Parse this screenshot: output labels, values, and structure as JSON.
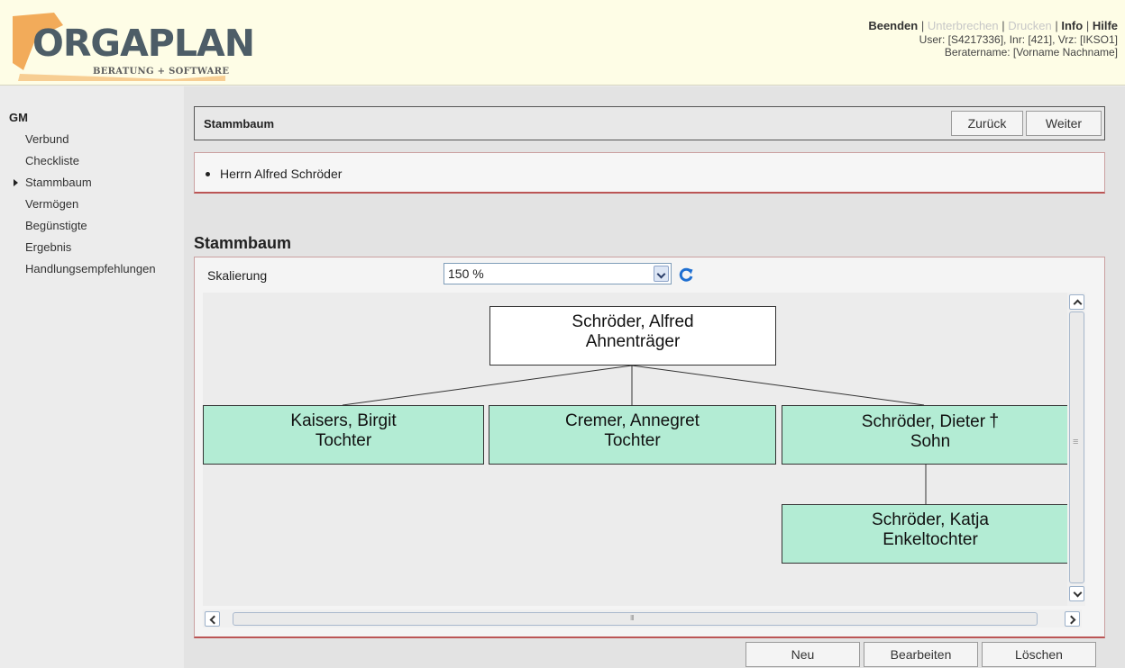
{
  "brand": {
    "name": "ORGAPLAN",
    "tagline": "BERATUNG + SOFTWARE"
  },
  "topnav": {
    "items": [
      {
        "label": "Beenden",
        "state": "active"
      },
      {
        "label": "Unterbrechen",
        "state": "disabled"
      },
      {
        "label": "Drucken",
        "state": "disabled"
      },
      {
        "label": "Info",
        "state": "active"
      },
      {
        "label": "Hilfe",
        "state": "active"
      }
    ],
    "separator": "|"
  },
  "userinfo": {
    "line1": "User: [S4217336], Inr: [421], Vrz: [IKSO1]",
    "line2": "Beratername: [Vorname Nachname]"
  },
  "sidebar": {
    "group": "GM",
    "items": [
      {
        "label": "Verbund"
      },
      {
        "label": "Checkliste"
      },
      {
        "label": "Stammbaum"
      },
      {
        "label": "Vermögen"
      },
      {
        "label": "Begünstigte"
      },
      {
        "label": "Ergebnis"
      },
      {
        "label": "Handlungsempfehlungen"
      }
    ],
    "current": "Stammbaum"
  },
  "titlebar": {
    "label": "Stammbaum",
    "back_label": "Zurück",
    "next_label": "Weiter"
  },
  "infobox": {
    "item": "Herrn Alfred Schröder"
  },
  "section": {
    "title": "Stammbaum"
  },
  "scale": {
    "label": "Skalierung",
    "value": "150 %"
  },
  "tree": {
    "root": {
      "name": "Schröder, Alfred",
      "role": "Ahnenträger"
    },
    "children": [
      {
        "name": "Kaisers, Birgit",
        "role": "Tochter",
        "deceased": false
      },
      {
        "name": "Cremer, Annegret",
        "role": "Tochter",
        "deceased": false
      },
      {
        "name": "Schröder, Dieter",
        "role": "Sohn",
        "deceased": true,
        "marker": "†"
      }
    ],
    "grandchildren": [
      {
        "name": "Schröder, Katja",
        "role": "Enkeltochter",
        "parent": "Schröder, Dieter"
      }
    ]
  },
  "colors": {
    "header_bg": "#fefde6",
    "node_child_bg": "#b3ecd4",
    "node_root_bg": "#ffffff",
    "panel_accent": "#bb5555",
    "logo_orange": "#f1a24a",
    "logo_gray": "#4d5d67",
    "refresh_blue": "#1f6fd1"
  },
  "actions": {
    "new_label": "Neu",
    "edit_label": "Bearbeiten",
    "delete_label": "Löschen"
  }
}
